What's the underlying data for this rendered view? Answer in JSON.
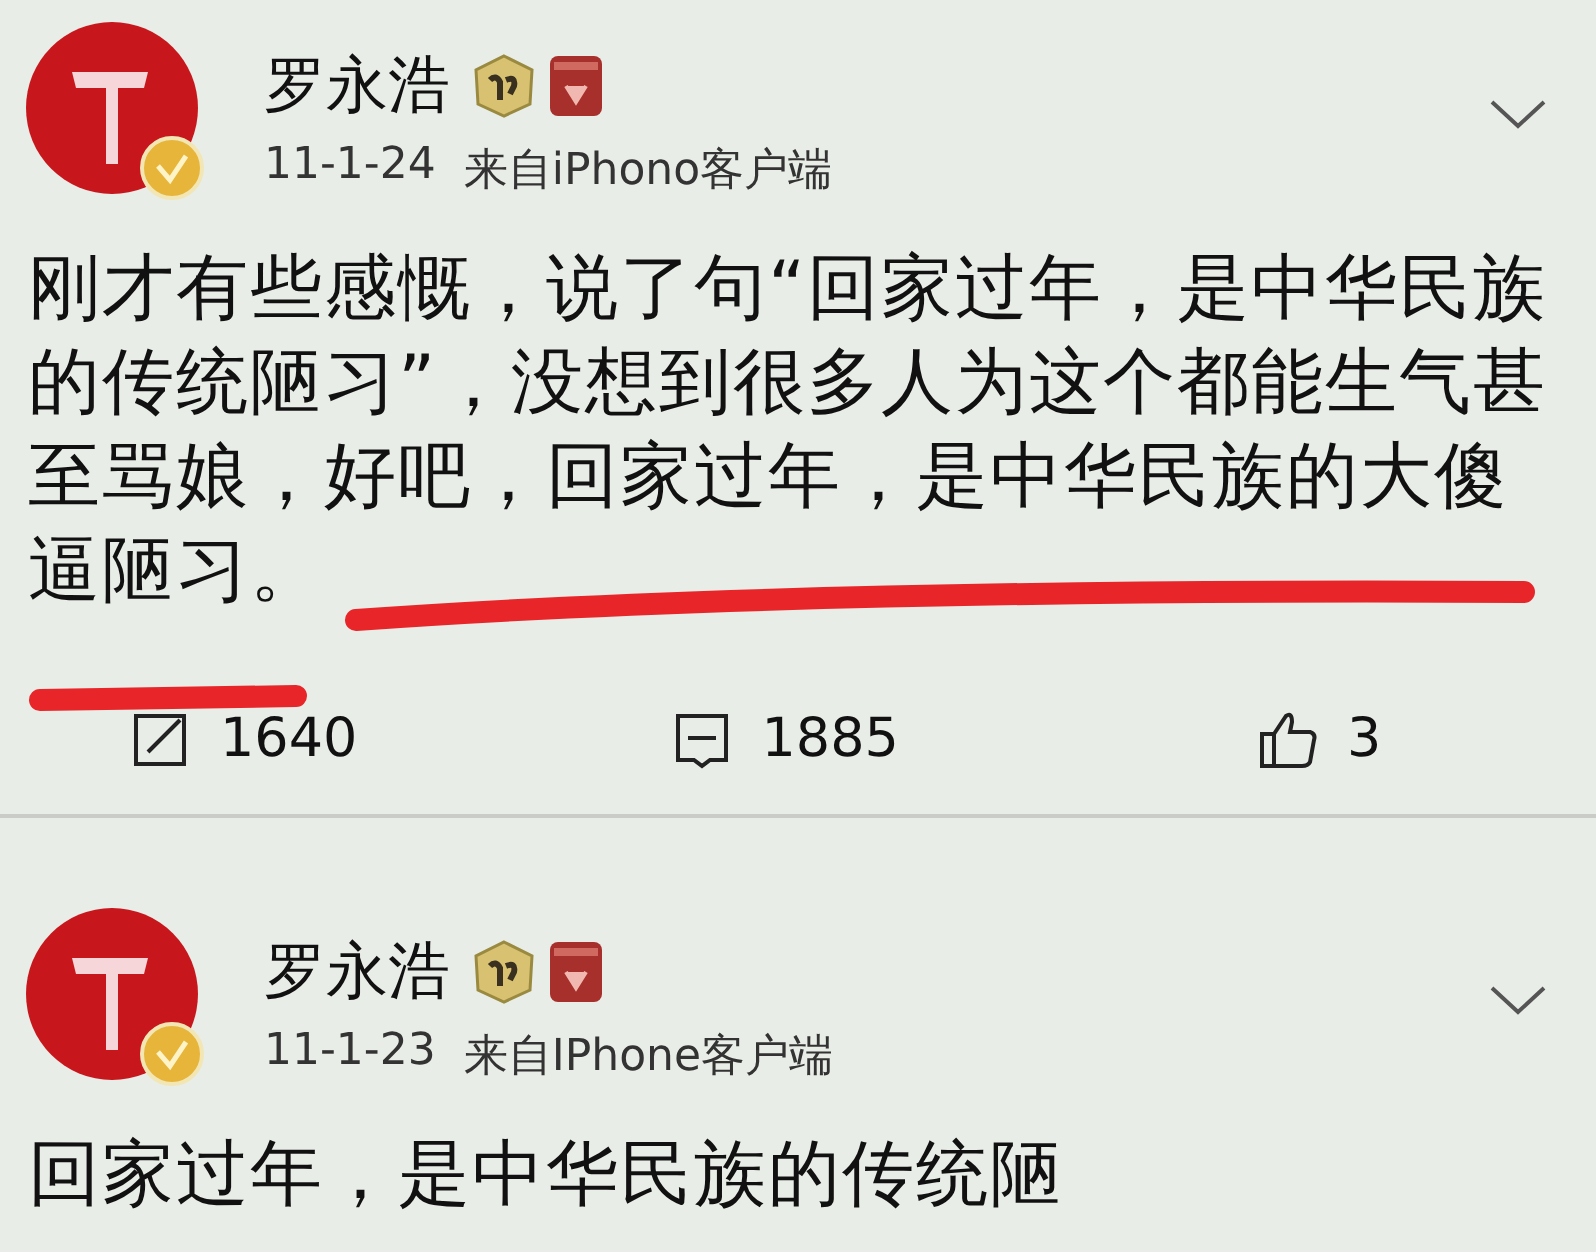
{
  "posts": [
    {
      "author": "罗永浩",
      "time": "11-1-24",
      "source": "来自iPhono客户端",
      "text_lines": [
        "刚才有些感慨，说了句“回家过年，是中华民族",
        "的传统陋习”，没想到很多人为这个都能生气甚",
        "至骂娘，好吧，回家过年，是中华民族的大傻",
        "逼陋习。"
      ],
      "highlighted": true,
      "stats": [
        {
          "kind": "repost",
          "count": "1640"
        },
        {
          "kind": "comment",
          "count": "1885"
        },
        {
          "kind": "like",
          "count": "3"
        }
      ]
    },
    {
      "author": "罗永浩",
      "time": "11-1-23",
      "source": "来自IPhone客户端",
      "text_lines": [
        "回家过年，是中华民族的传统陋"
      ],
      "highlighted": false
    }
  ]
}
